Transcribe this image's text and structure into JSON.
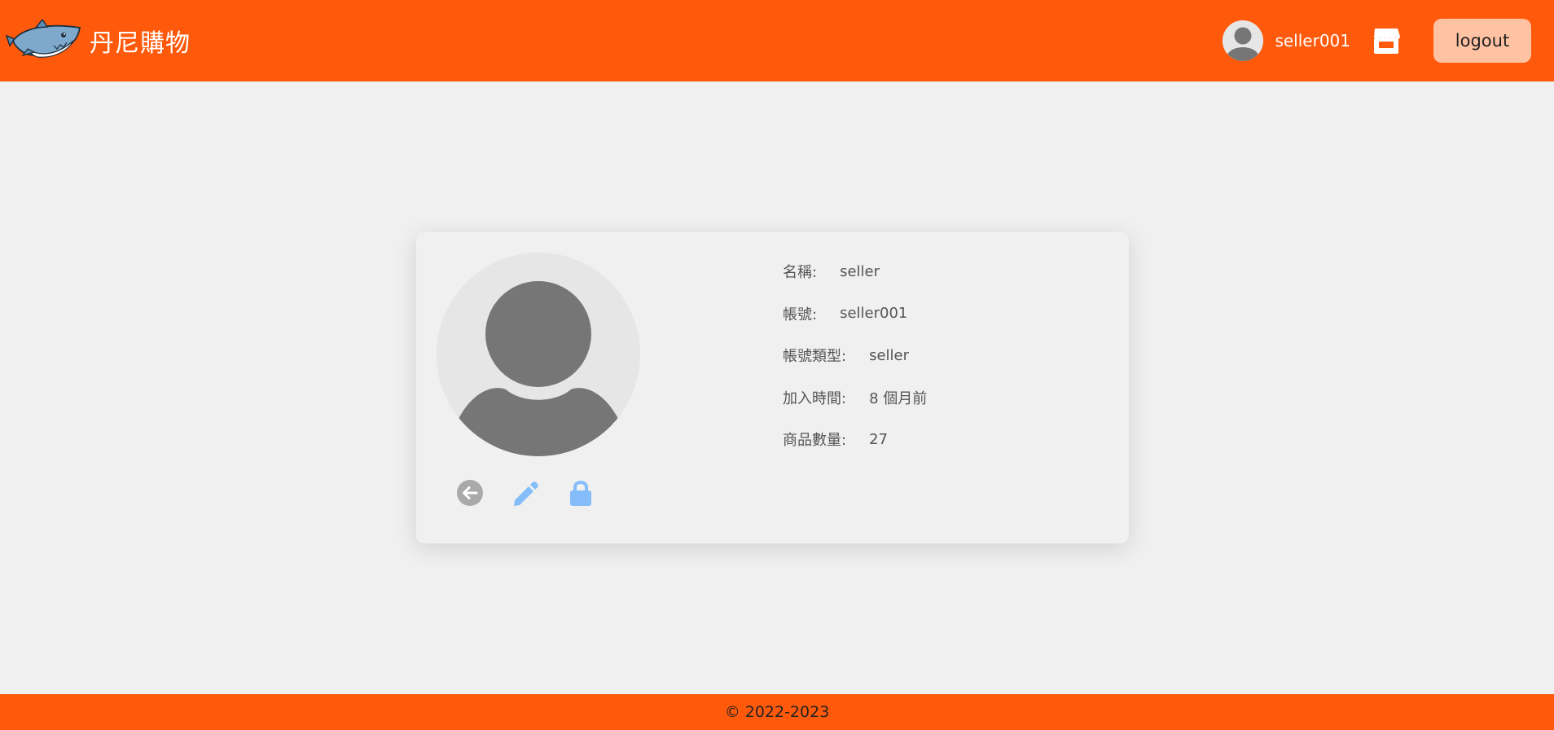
{
  "header": {
    "brand_name": "丹尼購物",
    "logo_icon": "shark-logo-icon",
    "username": "seller001",
    "store_icon": "store-icon",
    "logout_label": "logout",
    "background_color": "#ff5a0c"
  },
  "profile": {
    "avatar_icon": "user-avatar-icon",
    "fields": [
      {
        "label": "名稱:",
        "value": "seller"
      },
      {
        "label": "帳號:",
        "value": "seller001"
      },
      {
        "label": "帳號類型:",
        "value": "seller"
      },
      {
        "label": "加入時間:",
        "value": "8 個月前"
      },
      {
        "label": "商品數量:",
        "value": "27"
      }
    ],
    "actions": [
      {
        "icon": "back-arrow-icon",
        "color": "#a9a9a9"
      },
      {
        "icon": "pencil-icon",
        "color": "#84bdf9"
      },
      {
        "icon": "lock-icon",
        "color": "#84bdf9"
      }
    ]
  },
  "footer": {
    "copyright": "© 2022-2023"
  }
}
